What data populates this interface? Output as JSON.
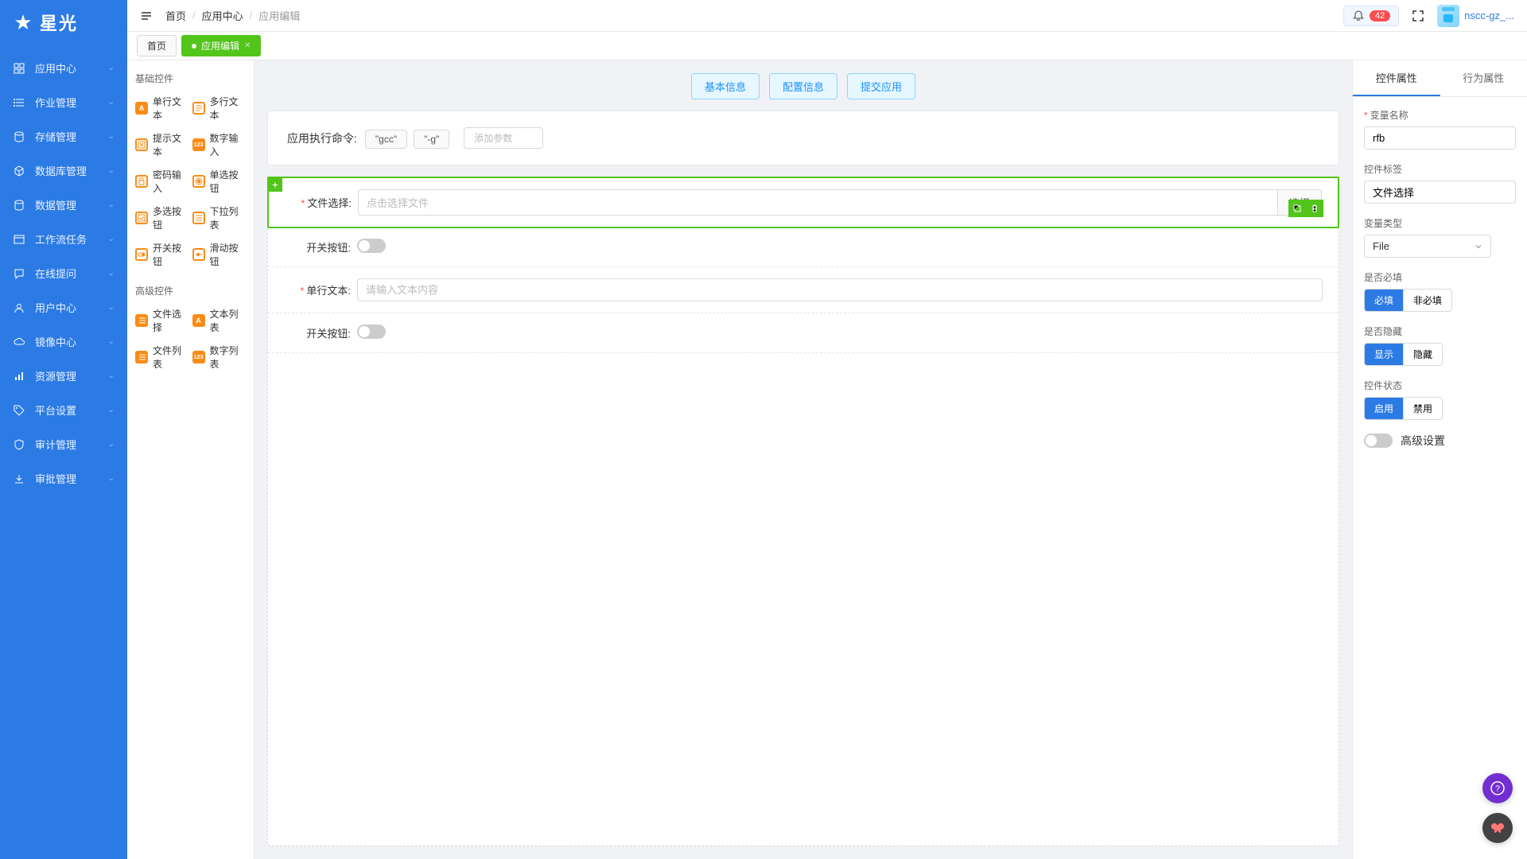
{
  "logo": "星光",
  "sidebar": [
    {
      "label": "应用中心",
      "icon": "grid"
    },
    {
      "label": "作业管理",
      "icon": "list"
    },
    {
      "label": "存储管理",
      "icon": "db"
    },
    {
      "label": "数据库管理",
      "icon": "cube"
    },
    {
      "label": "数据管理",
      "icon": "db"
    },
    {
      "label": "工作流任务",
      "icon": "flow"
    },
    {
      "label": "在线提问",
      "icon": "chat"
    },
    {
      "label": "用户中心",
      "icon": "user"
    },
    {
      "label": "镜像中心",
      "icon": "cloud"
    },
    {
      "label": "资源管理",
      "icon": "bars"
    },
    {
      "label": "平台设置",
      "icon": "tag"
    },
    {
      "label": "审计管理",
      "icon": "shield"
    },
    {
      "label": "审批管理",
      "icon": "download"
    }
  ],
  "breadcrumb": [
    "首页",
    "应用中心",
    "应用编辑"
  ],
  "notif_count": "42",
  "username": "nscc-gz_...",
  "tabs": [
    {
      "label": "首页",
      "active": false
    },
    {
      "label": "应用编辑",
      "active": true
    }
  ],
  "palette": {
    "section1_title": "基础控件",
    "section1": [
      {
        "label": "单行文本",
        "name": "single-text"
      },
      {
        "label": "多行文本",
        "name": "multi-text"
      },
      {
        "label": "提示文本",
        "name": "hint-text"
      },
      {
        "label": "数字输入",
        "name": "number-input"
      },
      {
        "label": "密码输入",
        "name": "password-input"
      },
      {
        "label": "单选按钮",
        "name": "radio"
      },
      {
        "label": "多选按钮",
        "name": "checkbox"
      },
      {
        "label": "下拉列表",
        "name": "select"
      },
      {
        "label": "开关按钮",
        "name": "switch"
      },
      {
        "label": "滑动按钮",
        "name": "slider"
      }
    ],
    "section2_title": "高级控件",
    "section2": [
      {
        "label": "文件选择",
        "name": "file-select"
      },
      {
        "label": "文本列表",
        "name": "text-list"
      },
      {
        "label": "文件列表",
        "name": "file-list"
      },
      {
        "label": "数字列表",
        "name": "number-list"
      }
    ]
  },
  "actions": [
    "基本信息",
    "配置信息",
    "提交应用"
  ],
  "cmd_label": "应用执行命令:",
  "cmd_chips": [
    "\"gcc\"",
    "\"-g\""
  ],
  "add_param_placeholder": "添加参数",
  "form": [
    {
      "label": "文件选择:",
      "required": true,
      "type": "file",
      "placeholder": "点击选择文件",
      "btn": "选择",
      "selected": true
    },
    {
      "label": "开关按钮:",
      "required": false,
      "type": "switch"
    },
    {
      "label": "单行文本:",
      "required": true,
      "type": "text",
      "placeholder": "请输入文本内容"
    },
    {
      "label": "开关按钮:",
      "required": false,
      "type": "switch"
    }
  ],
  "props": {
    "tab1": "控件属性",
    "tab2": "行为属性",
    "var_name_label": "变量名称",
    "var_name_value": "rfb",
    "widget_label_label": "控件标签",
    "widget_label_value": "文件选择",
    "var_type_label": "变量类型",
    "var_type_value": "File",
    "required_label": "是否必填",
    "required_opts": [
      "必填",
      "非必填"
    ],
    "hidden_label": "是否隐藏",
    "hidden_opts": [
      "显示",
      "隐藏"
    ],
    "state_label": "控件状态",
    "state_opts": [
      "启用",
      "禁用"
    ],
    "adv_label": "高级设置"
  }
}
